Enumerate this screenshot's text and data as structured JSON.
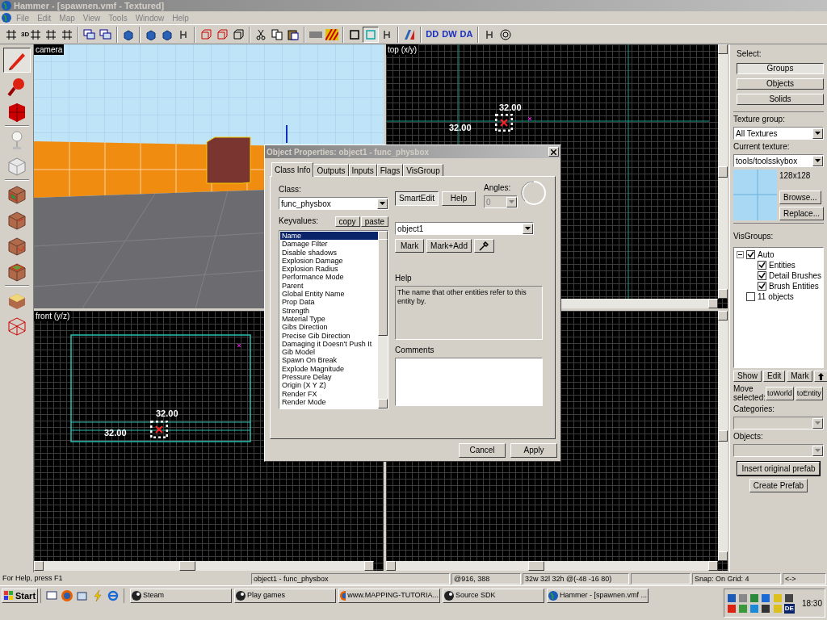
{
  "window": {
    "title": "Hammer - [spawnen.vmf - Textured]"
  },
  "menu": [
    {
      "label": "File",
      "disabled": true
    },
    {
      "label": "Edit",
      "disabled": true
    },
    {
      "label": "Map",
      "disabled": true
    },
    {
      "label": "View",
      "disabled": true
    },
    {
      "label": "Tools",
      "disabled": true
    },
    {
      "label": "Window",
      "disabled": true
    },
    {
      "label": "Help",
      "disabled": true
    }
  ],
  "toolbar": [
    {
      "kind": "grid"
    },
    {
      "kind": "grid",
      "text": "3D"
    },
    {
      "kind": "grid"
    },
    {
      "kind": "grid"
    },
    {
      "kind": "sep"
    },
    {
      "kind": "layers"
    },
    {
      "kind": "layers"
    },
    {
      "kind": "sep"
    },
    {
      "kind": "cube"
    },
    {
      "kind": "sep"
    },
    {
      "kind": "cube"
    },
    {
      "kind": "cube"
    },
    {
      "kind": "bracket"
    },
    {
      "kind": "sep"
    },
    {
      "kind": "outline"
    },
    {
      "kind": "outline"
    },
    {
      "kind": "outline"
    },
    {
      "kind": "sep"
    },
    {
      "kind": "scissors"
    },
    {
      "kind": "copy"
    },
    {
      "kind": "paste"
    },
    {
      "kind": "sep"
    },
    {
      "kind": "block"
    },
    {
      "kind": "stripes"
    },
    {
      "kind": "sep"
    },
    {
      "kind": "frame",
      "selected": false
    },
    {
      "kind": "frame",
      "selected": true
    },
    {
      "kind": "bracket"
    },
    {
      "kind": "sep"
    },
    {
      "kind": "split"
    },
    {
      "kind": "sep"
    },
    {
      "kind": "letters",
      "text": "DD"
    },
    {
      "kind": "letters",
      "text": "DW"
    },
    {
      "kind": "letters",
      "text": "DA"
    },
    {
      "kind": "sep"
    },
    {
      "kind": "bracket"
    },
    {
      "kind": "target"
    }
  ],
  "tools": [
    {
      "kind": "pointer",
      "selected": true
    },
    {
      "kind": "magnifier",
      "selected": false
    },
    {
      "kind": "red-block",
      "selected": false
    },
    {
      "kind": "entity",
      "selected": false
    },
    {
      "kind": "cube",
      "selected": false
    },
    {
      "kind": "textured",
      "selected": false
    },
    {
      "kind": "textured",
      "selected": false
    },
    {
      "kind": "textured",
      "selected": false
    },
    {
      "kind": "textured",
      "selected": false
    },
    {
      "kind": "yellow",
      "selected": false
    },
    {
      "kind": "wire",
      "selected": false
    }
  ],
  "viewports": [
    {
      "kind": "camera",
      "label": "camera"
    },
    {
      "kind": "top",
      "label": "top (x/y)",
      "dims": [
        "32.00",
        "32.00"
      ]
    },
    {
      "kind": "front",
      "label": "front (y/z)",
      "dims": [
        "32.00",
        "32.00"
      ]
    },
    {
      "kind": "side"
    }
  ],
  "right_panel": {
    "select_label": "Select:",
    "select_buttons": [
      {
        "label": "Groups",
        "selected": true
      },
      {
        "label": "Objects",
        "selected": false
      },
      {
        "label": "Solids",
        "selected": false
      }
    ],
    "texture_group_label": "Texture group:",
    "texture_group": "All Textures",
    "current_texture_label": "Current texture:",
    "current_texture": "tools/toolsskybox",
    "texture_size": "128x128",
    "browse": "Browse...",
    "replace": "Replace...",
    "visgroups_label": "VisGroups:",
    "visgroups": [
      {
        "label": "Auto",
        "checked": true,
        "expanded": true,
        "children": [
          {
            "label": "Entities",
            "checked": true
          },
          {
            "label": "Detail Brushes",
            "checked": true
          },
          {
            "label": "Brush Entities",
            "checked": true
          }
        ]
      },
      {
        "label": "11 objects",
        "checked": false
      }
    ],
    "visgroup_buttons": [
      "Show",
      "Edit",
      "Mark"
    ],
    "move_label": "Move selected:",
    "move_buttons": [
      "toWorld",
      "toEntity"
    ],
    "categories_label": "Categories:",
    "objects_label": "Objects:",
    "prefab_buttons": [
      "Insert original prefab",
      "Create Prefab"
    ]
  },
  "dialog": {
    "title": "Object Properties: object1 - func_physbox",
    "tabs": [
      {
        "label": "Class Info",
        "selected": true
      },
      {
        "label": "Outputs",
        "selected": false
      },
      {
        "label": "Inputs",
        "selected": false
      },
      {
        "label": "Flags",
        "selected": false
      },
      {
        "label": "VisGroup",
        "selected": false
      }
    ],
    "class_label": "Class:",
    "class_value": "func_physbox",
    "smartedit": {
      "label": "SmartEdit",
      "on": true
    },
    "help_button": "Help",
    "angles_label": "Angles:",
    "angles_value": "0",
    "keyvalues_label": "Keyvalues:",
    "copy": "copy",
    "paste": "paste",
    "keys": [
      {
        "label": "Name",
        "selected": true
      },
      {
        "label": "Damage Filter",
        "selected": false
      },
      {
        "label": "Disable shadows",
        "selected": false
      },
      {
        "label": "Explosion Damage",
        "selected": false
      },
      {
        "label": "Explosion Radius",
        "selected": false
      },
      {
        "label": "Performance Mode",
        "selected": false
      },
      {
        "label": "Parent",
        "selected": false
      },
      {
        "label": "Global Entity Name",
        "selected": false
      },
      {
        "label": "Prop Data",
        "selected": false
      },
      {
        "label": "Strength",
        "selected": false
      },
      {
        "label": "Material Type",
        "selected": false
      },
      {
        "label": "Gibs Direction",
        "selected": false
      },
      {
        "label": "Precise Gib Direction",
        "selected": false
      },
      {
        "label": "Damaging it Doesn't Push It",
        "selected": false
      },
      {
        "label": "Gib Model",
        "selected": false
      },
      {
        "label": "Spawn On Break",
        "selected": false
      },
      {
        "label": "Explode Magnitude",
        "selected": false
      },
      {
        "label": "Pressure Delay",
        "selected": false
      },
      {
        "label": "Origin (X Y Z)",
        "selected": false
      },
      {
        "label": "Render FX",
        "selected": false
      },
      {
        "label": "Render Mode",
        "selected": false
      }
    ],
    "value": "object1",
    "mark": "Mark",
    "mark_add": "Mark+Add",
    "help_label": "Help",
    "help_text": "The name that other entities refer to this entity by.",
    "comments_label": "Comments",
    "buttons": [
      "Cancel",
      "Apply"
    ]
  },
  "status_bar": [
    "For Help, press F1",
    "object1 - func_physbox",
    "@916, 388",
    "32w 32l 32h @(-48 -16 80)",
    "Snap: On Grid: 4",
    "<->"
  ],
  "taskbar": {
    "start": "Start",
    "tasks": [
      {
        "label": "Steam"
      },
      {
        "label": "Play games"
      },
      {
        "label": "www.MAPPING-TUTORIA..."
      },
      {
        "label": "Source SDK"
      },
      {
        "label": "Hammer - [spawnen.vmf ..."
      }
    ],
    "tray_text": "DE",
    "clock": "18:30"
  }
}
